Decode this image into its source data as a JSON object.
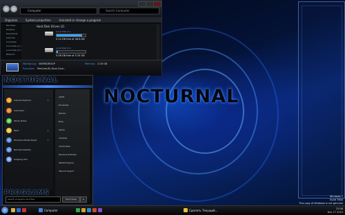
{
  "explorer": {
    "address": "Computer",
    "search_placeholder": "Search Computer",
    "toolbar": [
      "Organize",
      "System properties",
      "Uninstall or change a program"
    ],
    "nav_items": [
      "Favorites",
      "Desktop",
      "Downloads",
      "Libraries",
      "Computer",
      "Local Disk (C:)",
      "Local Disk (D:)",
      "Network"
    ],
    "drives_header": "Hard Disk Drives (2)",
    "drives": [
      {
        "name": "Local Disk (C:)",
        "free": "5.14 GB free of 48.8 GB",
        "used_fraction": 0.89
      },
      {
        "name": "Local Disk (D:)",
        "free": "5.06 GB free of 5.34 GB",
        "used_fraction": 0.05
      }
    ],
    "workgroup_label": "Workgroup:",
    "workgroup_value": "WORKGROUP",
    "memory_label": "Memory:",
    "memory_value": "2.00 GB",
    "processor_label": "Processor:",
    "processor_value": "Pentium(R) Dual-Core..."
  },
  "wallpaper": {
    "wordmark": "NOCTURNAL"
  },
  "startmenu": {
    "title": "NOCTURNAL",
    "left_items": [
      "Internet Explorer",
      "Calculator",
      "Sticky Notes",
      "Paint",
      "Windows Media Player",
      "Remote Desktop",
      "Snipping Tool"
    ],
    "right_items": [
      "user01",
      "Documents",
      "Pictures",
      "Music",
      "Games",
      "Computer",
      "Control Panel",
      "Devices and Printers",
      "Default Programs",
      "Help and Support"
    ],
    "programs_label": "PROGRAMS",
    "search_placeholder": "Search programs and files",
    "shutdown_label": "Shut down",
    "arrow": "▸"
  },
  "sidebar": {
    "watermark_line1": "Windows 7",
    "watermark_line2": "Build 7600",
    "watermark_line3": "This copy of Windows is not genuine"
  },
  "taskbar": {
    "item_computer": "Computer",
    "item_paint": "Сделать Текущий...",
    "time": "22:06",
    "date": "Dec 17 2010"
  }
}
